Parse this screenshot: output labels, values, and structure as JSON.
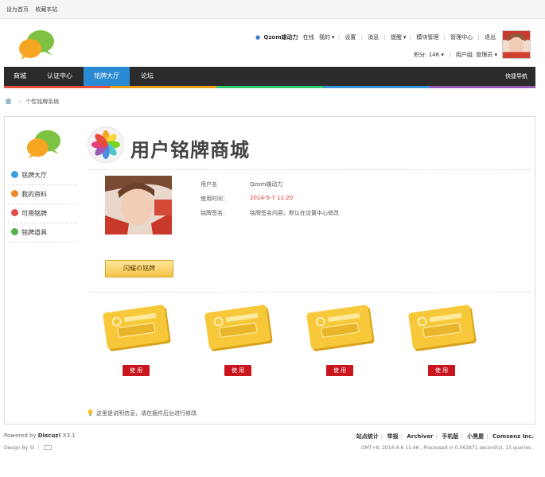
{
  "topbar": {
    "set_home": "设为首页",
    "bookmark": "收藏本站"
  },
  "user": {
    "username": "Qzom雄动力",
    "online": "在线",
    "mine": "我的",
    "settings": "设置",
    "messages": "消息",
    "reminders": "提醒",
    "module_mgmt": "模块管理",
    "admin_center": "管理中心",
    "logout": "退出",
    "points": "积分: 146",
    "group": "用户组: 管理员"
  },
  "nav": {
    "items": [
      {
        "label": "商城"
      },
      {
        "label": "认证中心"
      },
      {
        "label": "铭牌大厅"
      },
      {
        "label": "论坛"
      }
    ],
    "quick": "快捷导航"
  },
  "breadcrumb": {
    "current": "个性铭牌系统"
  },
  "side_menu": {
    "items": [
      {
        "label": "铭牌大厅",
        "color": "#3aa0e0"
      },
      {
        "label": "我的资料",
        "color": "#f0892a"
      },
      {
        "label": "可用铭牌",
        "color": "#e14b4b"
      },
      {
        "label": "铭牌道具",
        "color": "#55b34a"
      }
    ]
  },
  "banner": {
    "title": "用户铭牌商城"
  },
  "profile": {
    "username_label": "用户名",
    "username_value": "Qzom雄动力",
    "time_label": "使用时间：",
    "time_value": "2014-5-7 11:20",
    "sign_label": "铭牌签名：",
    "sign_value": "铭牌签名内容，默认在设置中心修改"
  },
  "flash_button": "闪耀の铭牌",
  "medals": [
    {
      "use_label": "使 用"
    },
    {
      "use_label": "使 用"
    },
    {
      "use_label": "使 用"
    },
    {
      "use_label": "使 用"
    }
  ],
  "note": "这里是说明信息，请在插件后台进行修改",
  "footer": {
    "powered_prefix": "Powered by ",
    "powered_name": "Discuz!",
    "powered_version": " X3.1",
    "design": "Design By SI",
    "links": [
      "站点统计",
      "举报",
      "Archiver",
      "手机版",
      "小黑屋",
      "Comsenz Inc."
    ],
    "stats": "GMT+8, 2014-4-6 11:46 , Processed in 0.062871 second(s), 15 queries ."
  }
}
